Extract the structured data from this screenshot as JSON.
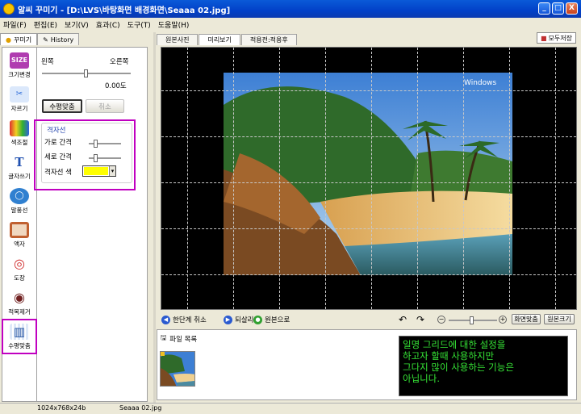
{
  "window": {
    "title": "알씨 꾸미기 - [D:\\LVS\\바탕화면 배경화면\\Seaaa 02.jpg]",
    "min": "_",
    "max": "□",
    "close": "X"
  },
  "menu": [
    "파일(F)",
    "편집(E)",
    "보기(V)",
    "효과(C)",
    "도구(T)",
    "도움말(H)"
  ],
  "left_tabs": {
    "decorate": "꾸미기",
    "history": "History"
  },
  "tools": [
    {
      "label": "크기변경",
      "icon": "size-icon",
      "icon_text": "SIZE",
      "color": "#b03cb0"
    },
    {
      "label": "자르기",
      "icon": "scissors-icon",
      "icon_text": "✂",
      "color": "#2a6ad8"
    },
    {
      "label": "색조절",
      "icon": "color-adjust-icon",
      "icon_text": "▦",
      "color": "#e05030"
    },
    {
      "label": "글자쓰기",
      "icon": "text-icon",
      "icon_text": "T",
      "color": "#2050b0"
    },
    {
      "label": "말풍선",
      "icon": "speech-bubble-icon",
      "icon_text": "◯",
      "color": "#3080d0"
    },
    {
      "label": "액자",
      "icon": "frame-icon",
      "icon_text": "▢",
      "color": "#c06030"
    },
    {
      "label": "도장",
      "icon": "stamp-icon",
      "icon_text": "◎",
      "color": "#d03030"
    },
    {
      "label": "적목제거",
      "icon": "red-eye-icon",
      "icon_text": "◉",
      "color": "#702020"
    },
    {
      "label": "수평맞춤",
      "icon": "level-icon",
      "icon_text": "▥",
      "color": "#2050a0"
    }
  ],
  "panel": {
    "left_label": "왼쪽",
    "right_label": "오른쪽",
    "angle_value": "0.00도",
    "level_button": "수평맞춤",
    "cancel_button": "취소",
    "grid_title": "격자선",
    "h_spacing_label": "가로 간격",
    "v_spacing_label": "세로 간격",
    "grid_color_label": "격자선 색",
    "grid_color": "#ffff00",
    "dropdown_arrow": "▾"
  },
  "view_tabs": [
    "원본사진",
    "미리보기",
    "적용전:적용후"
  ],
  "all_save": "모두저장",
  "photo": {
    "watermark": "Windows"
  },
  "bottom": {
    "undo": "한단계 취소",
    "redo": "되살리기",
    "original": "원본으로",
    "rotate_left": "↶",
    "rotate_right": "↷",
    "zoom_minus": "−",
    "zoom_plus": "+",
    "fit_screen": "화면맞춤",
    "actual_size": "원본크기"
  },
  "file_list": {
    "title": "파일 목록"
  },
  "note_lines": [
    "일명 그리드에 대한 설정을",
    "하고자 할때 사용하지만",
    "그다지 많이 사용하는 기능은",
    "아닙니다."
  ],
  "status": {
    "dimensions": "1024x768x24b",
    "filename": "Seaaa 02.jpg"
  }
}
